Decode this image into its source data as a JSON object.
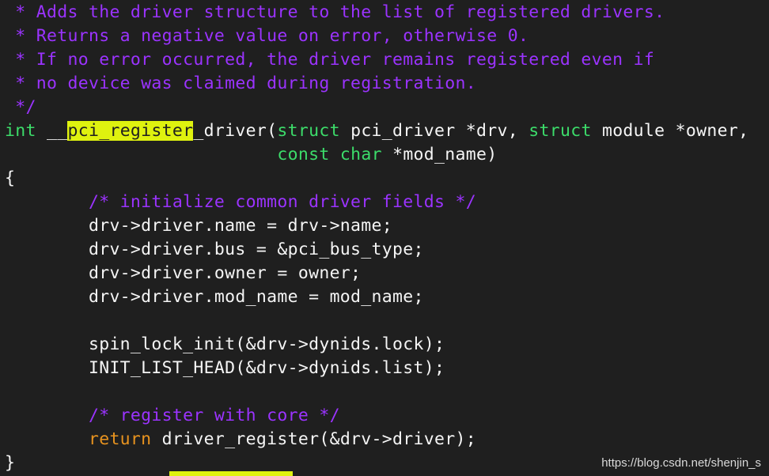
{
  "colors": {
    "background": "#1f1f1f",
    "default_text": "#f5f5f5",
    "comment": "#9b33ff",
    "type": "#3cdc6a",
    "keyword": "#e8931f",
    "highlight": "#dff20f"
  },
  "code": {
    "lines": [
      [
        {
          "t": " * Adds the driver structure to the list of registered drivers.",
          "c": "comment"
        }
      ],
      [
        {
          "t": " * Returns a negative value on error, otherwise 0.",
          "c": "comment"
        }
      ],
      [
        {
          "t": " * If no error occurred, the driver remains registered even if",
          "c": "comment"
        }
      ],
      [
        {
          "t": " * no device was claimed during registration.",
          "c": "comment"
        }
      ],
      [
        {
          "t": " */",
          "c": "comment"
        }
      ],
      [
        {
          "t": "int",
          "c": "type"
        },
        {
          "t": " __",
          "c": "text"
        },
        {
          "t": "pci_register",
          "c": "highlight"
        },
        {
          "t": "_driver(",
          "c": "text"
        },
        {
          "t": "struct",
          "c": "type"
        },
        {
          "t": " pci_driver *drv, ",
          "c": "text"
        },
        {
          "t": "struct",
          "c": "type"
        },
        {
          "t": " module *owner,",
          "c": "text"
        }
      ],
      [
        {
          "t": "                          ",
          "c": "text"
        },
        {
          "t": "const",
          "c": "type"
        },
        {
          "t": " ",
          "c": "text"
        },
        {
          "t": "char",
          "c": "type"
        },
        {
          "t": " *mod_name)",
          "c": "text"
        }
      ],
      [
        {
          "t": "{",
          "c": "text"
        }
      ],
      [
        {
          "t": "        /* initialize common driver fields */",
          "c": "comment"
        }
      ],
      [
        {
          "t": "        drv->driver.name = drv->name;",
          "c": "text"
        }
      ],
      [
        {
          "t": "        drv->driver.bus = &pci_bus_type;",
          "c": "text"
        }
      ],
      [
        {
          "t": "        drv->driver.owner = owner;",
          "c": "text"
        }
      ],
      [
        {
          "t": "        drv->driver.mod_name = mod_name;",
          "c": "text"
        }
      ],
      [
        {
          "t": "",
          "c": "text"
        }
      ],
      [
        {
          "t": "        spin_lock_init(&drv->dynids.lock);",
          "c": "text"
        }
      ],
      [
        {
          "t": "        INIT_LIST_HEAD(&drv->dynids.list);",
          "c": "text"
        }
      ],
      [
        {
          "t": "",
          "c": "text"
        }
      ],
      [
        {
          "t": "        /* register with core */",
          "c": "comment"
        }
      ],
      [
        {
          "t": "        ",
          "c": "text"
        },
        {
          "t": "return",
          "c": "keyword"
        },
        {
          "t": " driver_register(&drv->driver);",
          "c": "text"
        }
      ],
      [
        {
          "t": "}",
          "c": "text"
        }
      ]
    ]
  },
  "watermark": {
    "text": "https://blog.csdn.net/shenjin_s"
  }
}
